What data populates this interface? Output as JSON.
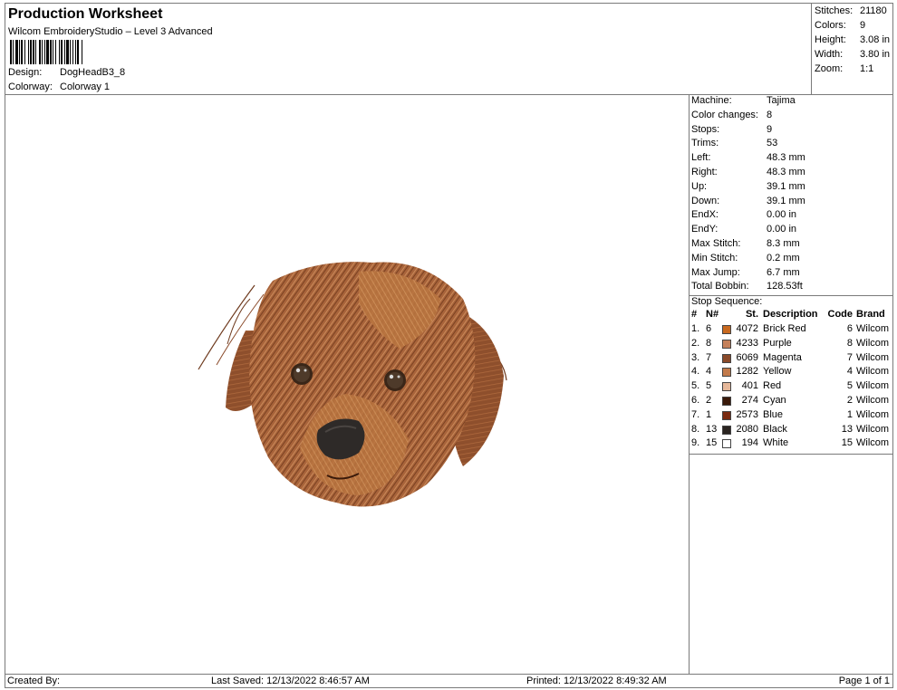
{
  "header": {
    "title": "Production Worksheet",
    "software": "Wilcom EmbroideryStudio – Level 3 Advanced",
    "design_label": "Design:",
    "design_value": "DogHeadB3_8",
    "colorway_label": "Colorway:",
    "colorway_value": "Colorway 1"
  },
  "summary": {
    "stitches_label": "Stitches:",
    "stitches": "21180",
    "colors_label": "Colors:",
    "colors": "9",
    "height_label": "Height:",
    "height": "3.08 in",
    "width_label": "Width:",
    "width": "3.80 in",
    "zoom_label": "Zoom:",
    "zoom": "1:1"
  },
  "machine_info": [
    {
      "label": "Machine:",
      "value": "Tajima"
    },
    {
      "label": "Color changes:",
      "value": "8"
    },
    {
      "label": "Stops:",
      "value": "9"
    },
    {
      "label": "Trims:",
      "value": "53"
    },
    {
      "label": "Left:",
      "value": "48.3 mm"
    },
    {
      "label": "Right:",
      "value": "48.3 mm"
    },
    {
      "label": "Up:",
      "value": "39.1 mm"
    },
    {
      "label": "Down:",
      "value": "39.1 mm"
    },
    {
      "label": "EndX:",
      "value": "0.00 in"
    },
    {
      "label": "EndY:",
      "value": "0.00 in"
    },
    {
      "label": "Max Stitch:",
      "value": "8.3 mm"
    },
    {
      "label": "Min Stitch:",
      "value": "0.2 mm"
    },
    {
      "label": "Max Jump:",
      "value": "6.7 mm"
    },
    {
      "label": "Total Bobbin:",
      "value": "128.53ft"
    }
  ],
  "stop_sequence": {
    "title": "Stop Sequence:",
    "headers": {
      "idx": "#",
      "n": "N#",
      "st": "St.",
      "desc": "Description",
      "code": "Code",
      "brand": "Brand"
    },
    "rows": [
      {
        "idx": "1.",
        "n": "6",
        "color": "#c8691f",
        "st": "4072",
        "desc": "Brick Red",
        "code": "6",
        "brand": "Wilcom"
      },
      {
        "idx": "2.",
        "n": "8",
        "color": "#c4805a",
        "st": "4233",
        "desc": "Purple",
        "code": "8",
        "brand": "Wilcom"
      },
      {
        "idx": "3.",
        "n": "7",
        "color": "#8a4a2a",
        "st": "6069",
        "desc": "Magenta",
        "code": "7",
        "brand": "Wilcom"
      },
      {
        "idx": "4.",
        "n": "4",
        "color": "#c27a4a",
        "st": "1282",
        "desc": "Yellow",
        "code": "4",
        "brand": "Wilcom"
      },
      {
        "idx": "5.",
        "n": "5",
        "color": "#e6b89a",
        "st": "401",
        "desc": "Red",
        "code": "5",
        "brand": "Wilcom"
      },
      {
        "idx": "6.",
        "n": "2",
        "color": "#3a1a0a",
        "st": "274",
        "desc": "Cyan",
        "code": "2",
        "brand": "Wilcom"
      },
      {
        "idx": "7.",
        "n": "1",
        "color": "#7a2a10",
        "st": "2573",
        "desc": "Blue",
        "code": "1",
        "brand": "Wilcom"
      },
      {
        "idx": "8.",
        "n": "13",
        "color": "#2a2420",
        "st": "2080",
        "desc": "Black",
        "code": "13",
        "brand": "Wilcom"
      },
      {
        "idx": "9.",
        "n": "15",
        "color": "#ffffff",
        "st": "194",
        "desc": "White",
        "code": "15",
        "brand": "Wilcom"
      }
    ]
  },
  "footer": {
    "created_by": "Created By:",
    "last_saved": "Last Saved: 12/13/2022 8:46:57 AM",
    "printed": "Printed: 12/13/2022 8:49:32 AM",
    "page": "Page 1 of 1"
  },
  "colors": {
    "border": "#7a7a7a",
    "fur_main": "#a8633a",
    "fur_light": "#c98a5a",
    "fur_dark": "#6e3a1e"
  }
}
